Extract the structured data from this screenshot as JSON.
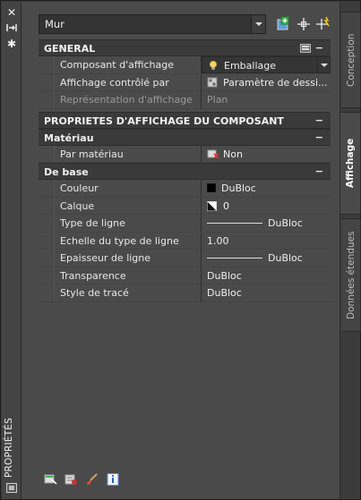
{
  "window": {
    "side_title": "PROPRIÉTÉS",
    "icons": [
      "close-icon",
      "auto-hide-icon",
      "settings-icon"
    ]
  },
  "toolbar": {
    "object_type": "Mur",
    "icons": [
      "add-new-icon",
      "select-objects-icon",
      "quick-select-icon"
    ]
  },
  "sections": {
    "general": {
      "title": "GENERAL",
      "toggle": "−",
      "rows": [
        {
          "label": "Composant d'affichage",
          "value": "Emballage"
        },
        {
          "label": "Affichage contrôlé par",
          "value": "Paramètre de dessi..."
        },
        {
          "label": "Représentation d'affichage",
          "value": "Plan"
        }
      ]
    },
    "component_props": {
      "title": "PROPRIETES D'AFFICHAGE DU COMPOSANT",
      "toggle": "−"
    },
    "material": {
      "title": "Matériau",
      "toggle": "−",
      "rows": [
        {
          "label": "Par matériau",
          "value": "Non"
        }
      ]
    },
    "base": {
      "title": "De base",
      "toggle": "−",
      "rows": [
        {
          "label": "Couleur",
          "value": "DuBloc"
        },
        {
          "label": "Calque",
          "value": "0"
        },
        {
          "label": "Type de ligne",
          "value": "DuBloc"
        },
        {
          "label": "Echelle du type de ligne",
          "value": "1.00"
        },
        {
          "label": "Epaisseur de ligne",
          "value": "DuBloc"
        },
        {
          "label": "Transparence",
          "value": "DuBloc"
        },
        {
          "label": "Style de tracé",
          "value": "DuBloc"
        }
      ]
    }
  },
  "tabs": [
    {
      "label": "Conception",
      "active": false
    },
    {
      "label": "Affichage",
      "active": true
    },
    {
      "label": "Données étendues",
      "active": false
    }
  ],
  "bottom_icons": [
    "select-display-icon",
    "edit-display-icon",
    "paint-brush-icon",
    "info-icon"
  ],
  "colors": {
    "panel": "#4a4a4a",
    "section": "#3a3a3a",
    "accent_green": "#3cb44a"
  }
}
